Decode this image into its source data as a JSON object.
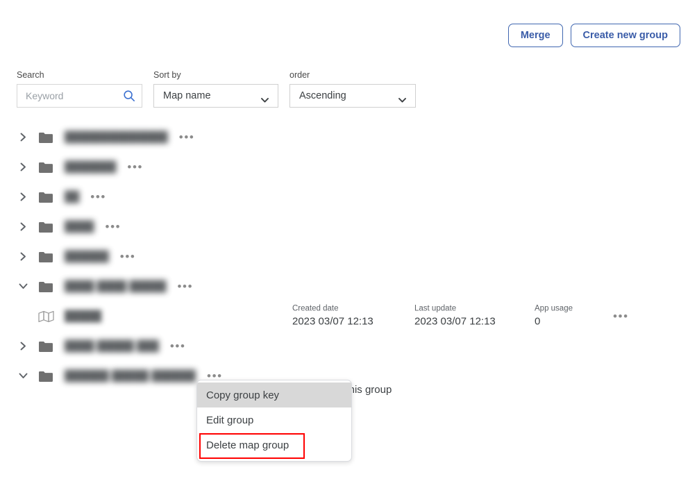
{
  "toolbar": {
    "merge_label": "Merge",
    "create_group_label": "Create new group",
    "accent_color": "#3a5ca8"
  },
  "filters": {
    "search": {
      "label": "Search",
      "placeholder": "Keyword",
      "value": "",
      "icon": "search-icon"
    },
    "sort_by": {
      "label": "Sort by",
      "value": "Map name"
    },
    "order": {
      "label": "order",
      "value": "Ascending"
    }
  },
  "tree": {
    "rows": [
      {
        "type": "group",
        "expanded": false,
        "name": "██████████████",
        "redacted": true,
        "dots": "•••"
      },
      {
        "type": "group",
        "expanded": false,
        "name": "███████",
        "redacted": true,
        "dots": "•••"
      },
      {
        "type": "group",
        "expanded": false,
        "name": "██",
        "redacted": true,
        "dots": "•••"
      },
      {
        "type": "group",
        "expanded": false,
        "name": "████",
        "redacted": true,
        "dots": "•••"
      },
      {
        "type": "group",
        "expanded": false,
        "name": "██████",
        "redacted": true,
        "dots": "•••"
      },
      {
        "type": "group",
        "expanded": true,
        "name": "████ ████ █████",
        "redacted": true,
        "dots": "•••"
      },
      {
        "type": "map",
        "name": "█████",
        "redacted": true
      },
      {
        "type": "group",
        "expanded": false,
        "name": "████ █████ ███",
        "redacted": true,
        "dots": "•••"
      },
      {
        "type": "group",
        "expanded": true,
        "name": "██████ █████ ██████",
        "redacted": true,
        "dots": "•••"
      }
    ]
  },
  "map_detail": {
    "created_label": "Created date",
    "created_value": "2023 03/07 12:13",
    "updated_label": "Last update",
    "updated_value": "2023 03/07 12:13",
    "usage_label": "App usage",
    "usage_value": "0",
    "dots": "•••"
  },
  "empty_group_message": "There is no map belonging to this group",
  "context_menu": {
    "items": [
      {
        "label": "Copy group key",
        "hovered": true
      },
      {
        "label": "Edit group",
        "hovered": false
      },
      {
        "label": "Delete map group",
        "hovered": false
      }
    ]
  },
  "annotation": {
    "target": "Delete map group",
    "color": "#ff0000"
  }
}
